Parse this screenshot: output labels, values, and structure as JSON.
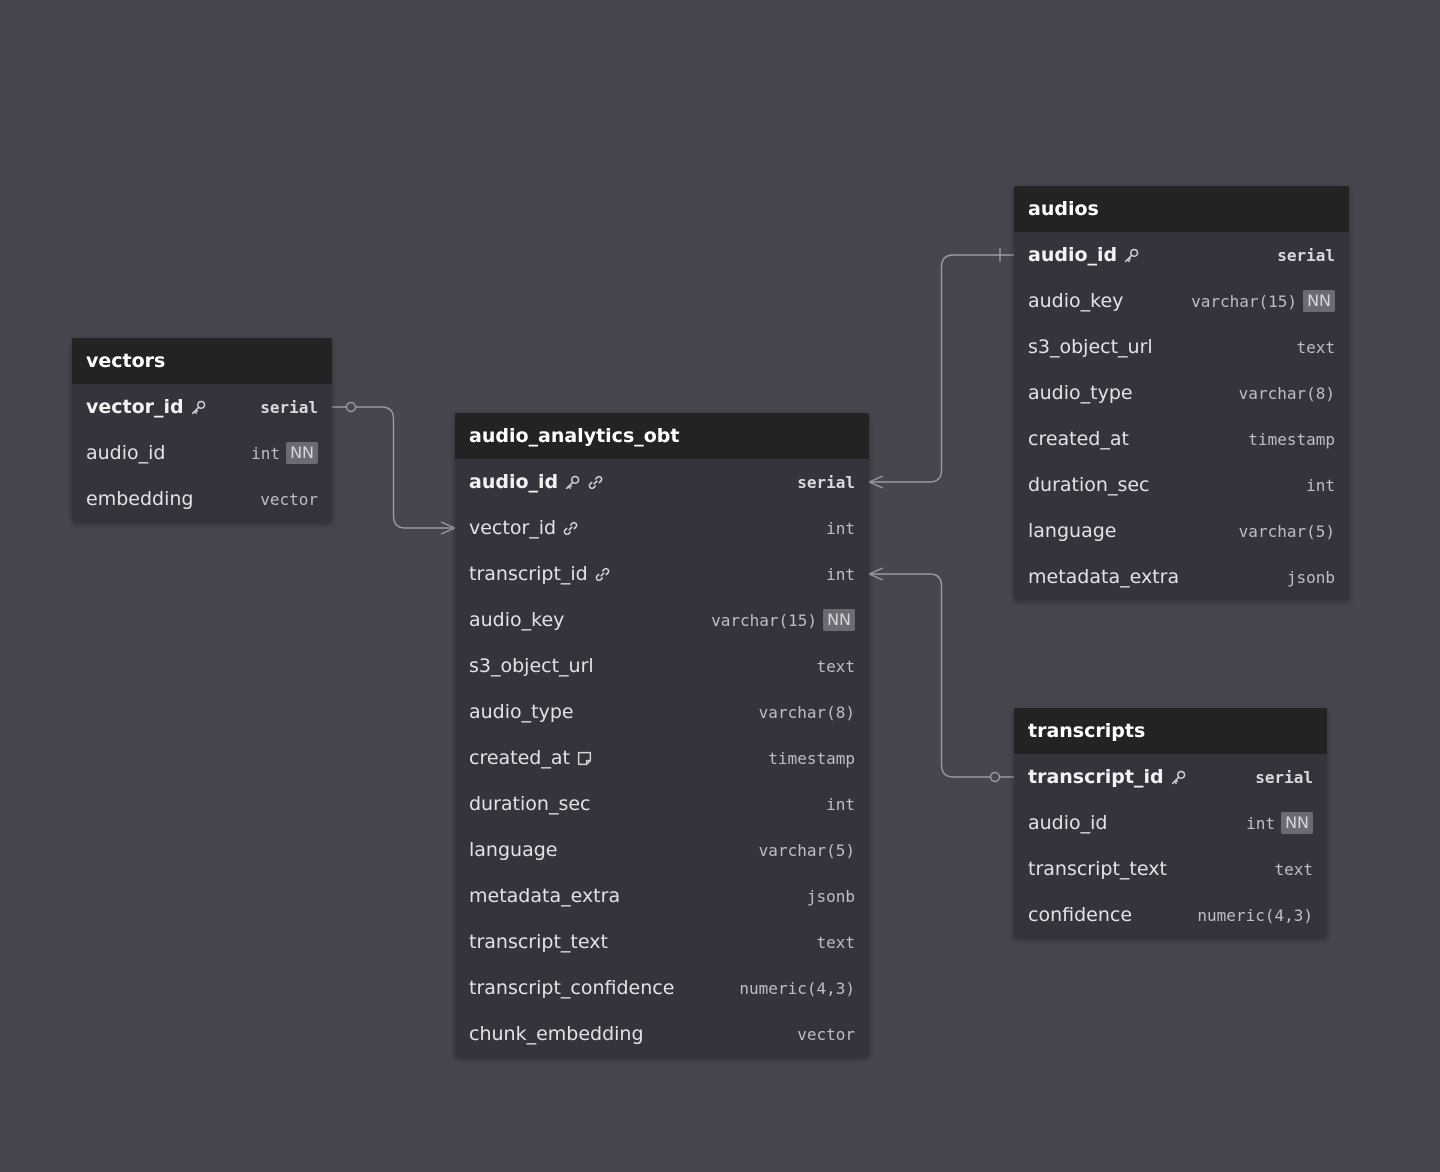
{
  "tables": [
    {
      "id": "vectors",
      "name": "vectors",
      "columns": [
        {
          "name": "vector_id",
          "type": "serial",
          "pk": true,
          "icons": [
            "key-icon"
          ],
          "nn": false
        },
        {
          "name": "audio_id",
          "type": "int",
          "pk": false,
          "icons": [],
          "nn": true
        },
        {
          "name": "embedding",
          "type": "vector",
          "pk": false,
          "icons": [],
          "nn": false
        }
      ]
    },
    {
      "id": "audio_analytics_obt",
      "name": "audio_analytics_obt",
      "columns": [
        {
          "name": "audio_id",
          "type": "serial",
          "pk": true,
          "icons": [
            "key-icon",
            "link-icon"
          ],
          "nn": false
        },
        {
          "name": "vector_id",
          "type": "int",
          "pk": false,
          "icons": [
            "link-icon"
          ],
          "nn": false
        },
        {
          "name": "transcript_id",
          "type": "int",
          "pk": false,
          "icons": [
            "link-icon"
          ],
          "nn": false
        },
        {
          "name": "audio_key",
          "type": "varchar(15)",
          "pk": false,
          "icons": [],
          "nn": true
        },
        {
          "name": "s3_object_url",
          "type": "text",
          "pk": false,
          "icons": [],
          "nn": false
        },
        {
          "name": "audio_type",
          "type": "varchar(8)",
          "pk": false,
          "icons": [],
          "nn": false
        },
        {
          "name": "created_at",
          "type": "timestamp",
          "pk": false,
          "icons": [
            "note-icon"
          ],
          "nn": false
        },
        {
          "name": "duration_sec",
          "type": "int",
          "pk": false,
          "icons": [],
          "nn": false
        },
        {
          "name": "language",
          "type": "varchar(5)",
          "pk": false,
          "icons": [],
          "nn": false
        },
        {
          "name": "metadata_extra",
          "type": "jsonb",
          "pk": false,
          "icons": [],
          "nn": false
        },
        {
          "name": "transcript_text",
          "type": "text",
          "pk": false,
          "icons": [],
          "nn": false
        },
        {
          "name": "transcript_confidence",
          "type": "numeric(4,3)",
          "pk": false,
          "icons": [],
          "nn": false
        },
        {
          "name": "chunk_embedding",
          "type": "vector",
          "pk": false,
          "icons": [],
          "nn": false
        }
      ]
    },
    {
      "id": "audios",
      "name": "audios",
      "columns": [
        {
          "name": "audio_id",
          "type": "serial",
          "pk": true,
          "icons": [
            "key-icon"
          ],
          "nn": false
        },
        {
          "name": "audio_key",
          "type": "varchar(15)",
          "pk": false,
          "icons": [],
          "nn": true
        },
        {
          "name": "s3_object_url",
          "type": "text",
          "pk": false,
          "icons": [],
          "nn": false
        },
        {
          "name": "audio_type",
          "type": "varchar(8)",
          "pk": false,
          "icons": [],
          "nn": false
        },
        {
          "name": "created_at",
          "type": "timestamp",
          "pk": false,
          "icons": [],
          "nn": false
        },
        {
          "name": "duration_sec",
          "type": "int",
          "pk": false,
          "icons": [],
          "nn": false
        },
        {
          "name": "language",
          "type": "varchar(5)",
          "pk": false,
          "icons": [],
          "nn": false
        },
        {
          "name": "metadata_extra",
          "type": "jsonb",
          "pk": false,
          "icons": [],
          "nn": false
        }
      ]
    },
    {
      "id": "transcripts",
      "name": "transcripts",
      "columns": [
        {
          "name": "transcript_id",
          "type": "serial",
          "pk": true,
          "icons": [
            "key-icon"
          ],
          "nn": false
        },
        {
          "name": "audio_id",
          "type": "int",
          "pk": false,
          "icons": [],
          "nn": true
        },
        {
          "name": "transcript_text",
          "type": "text",
          "pk": false,
          "icons": [],
          "nn": false
        },
        {
          "name": "confidence",
          "type": "numeric(4,3)",
          "pk": false,
          "icons": [],
          "nn": false
        }
      ]
    }
  ],
  "nn_label": "NN",
  "relationships": [
    {
      "from_table": "vectors",
      "from_column": "vector_id",
      "from_end": "zero-or-one",
      "to_table": "audio_analytics_obt",
      "to_column": "vector_id",
      "to_end": "many"
    },
    {
      "from_table": "audio_analytics_obt",
      "from_column": "audio_id",
      "from_end": "many",
      "to_table": "audios",
      "to_column": "audio_id",
      "to_end": "one"
    },
    {
      "from_table": "audio_analytics_obt",
      "from_column": "transcript_id",
      "from_end": "many",
      "to_table": "transcripts",
      "to_column": "transcript_id",
      "to_end": "zero-or-one"
    }
  ],
  "colors": {
    "background": "#46464f",
    "table_body": "#34343d",
    "table_header": "#232323",
    "connector": "#9a9aa2"
  }
}
